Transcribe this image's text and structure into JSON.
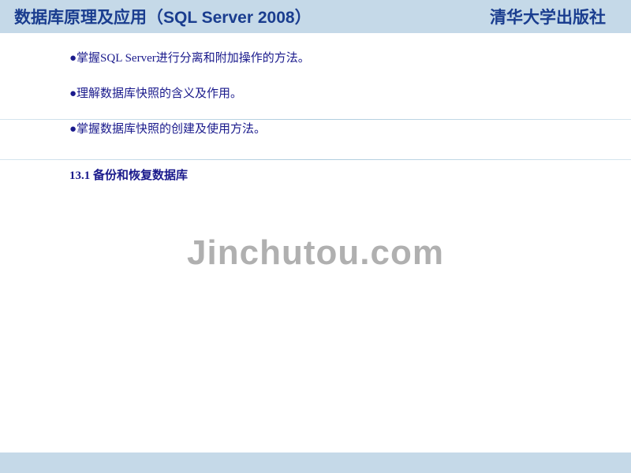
{
  "header": {
    "title_left": "数据库原理及应用（SQL Server 2008）",
    "title_right": "清华大学出版社"
  },
  "content": {
    "bullets": [
      "●掌握SQL Server进行分离和附加操作的方法。",
      "●理解数据库快照的含义及作用。",
      "●掌握数据库快照的创建及使用方法。"
    ],
    "section": "13.1  备份和恢复数据库"
  },
  "watermark": "Jinchutou.com"
}
